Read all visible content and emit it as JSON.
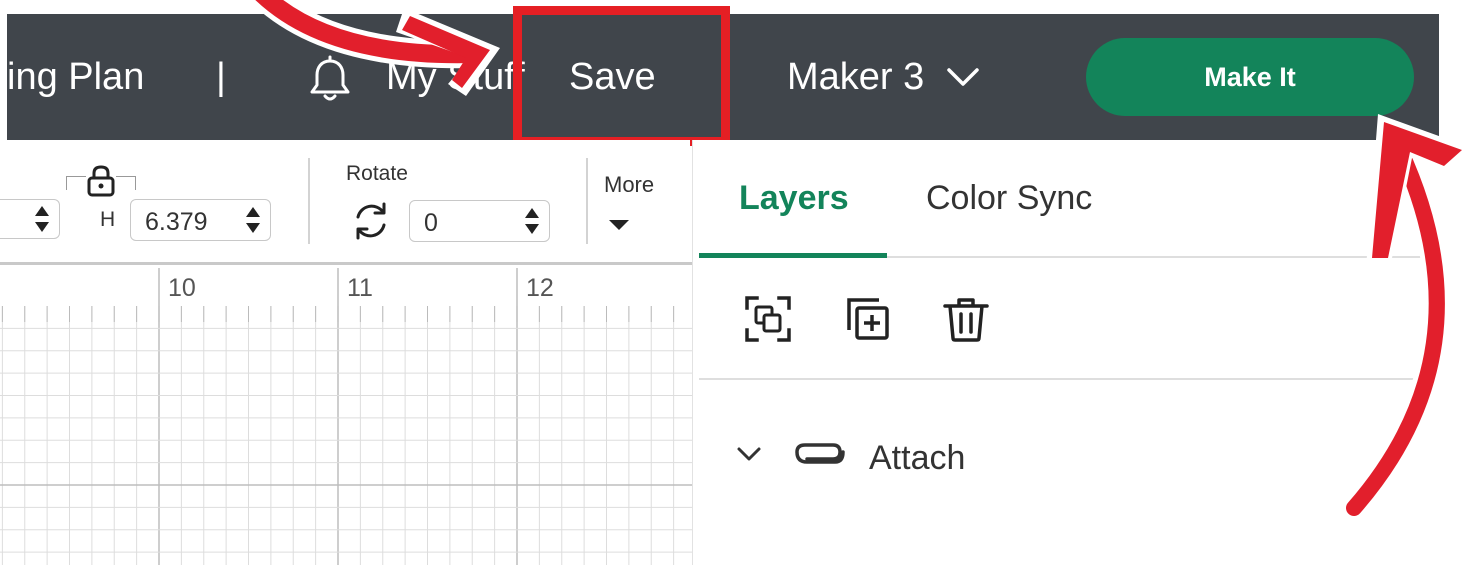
{
  "colors": {
    "topbar_bg": "#40454b",
    "accent_green": "#13845a",
    "highlight_red": "#e51f24"
  },
  "header": {
    "plan_fragment": "ing Plan",
    "separator": "|",
    "my_stuff_fragment": "My Stuff",
    "save_label": "Save",
    "machine_label": "Maker 3",
    "make_it_label": "Make It"
  },
  "toolbar": {
    "h_label": "H",
    "h_value": "6.379",
    "rotate_label": "Rotate",
    "rotate_value": "0",
    "more_label": "More"
  },
  "ruler": {
    "ticks": [
      "10",
      "11",
      "12"
    ]
  },
  "panel": {
    "tabs": [
      {
        "label": "Layers",
        "active": true
      },
      {
        "label": "Color Sync",
        "active": false
      }
    ],
    "actions": [
      "group-icon",
      "duplicate-icon",
      "delete-icon"
    ],
    "group_item": {
      "label": "Attach",
      "icon": "paperclip-icon",
      "expanded": true
    }
  }
}
